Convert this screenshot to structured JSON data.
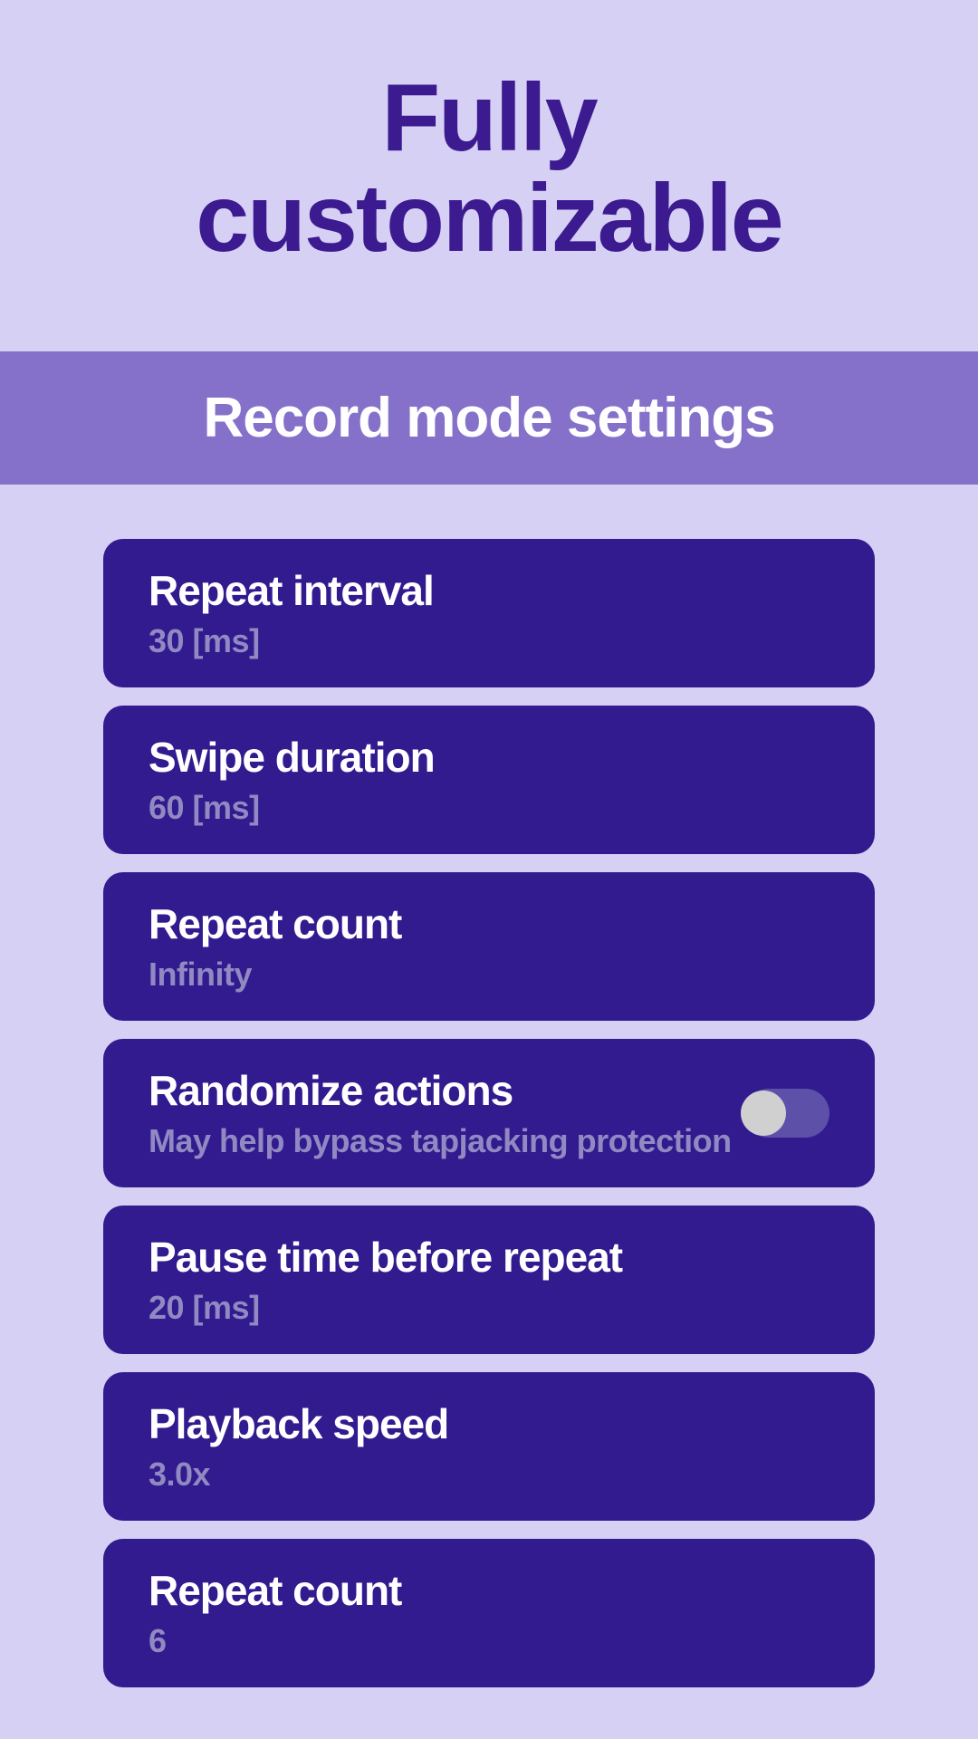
{
  "header": {
    "title_line1": "Fully",
    "title_line2": "customizable"
  },
  "section": {
    "title": "Record mode settings"
  },
  "settings": [
    {
      "title": "Repeat interval",
      "value": "30 [ms]",
      "has_toggle": false
    },
    {
      "title": "Swipe duration",
      "value": "60 [ms]",
      "has_toggle": false
    },
    {
      "title": "Repeat count",
      "value": "Infinity",
      "has_toggle": false
    },
    {
      "title": "Randomize actions",
      "value": "May help bypass tapjacking protection",
      "has_toggle": true,
      "toggle_state": "off"
    },
    {
      "title": "Pause time before repeat",
      "value": "20 [ms]",
      "has_toggle": false
    },
    {
      "title": "Playback speed",
      "value": "3.0x",
      "has_toggle": false
    },
    {
      "title": "Repeat count",
      "value": "6",
      "has_toggle": false
    }
  ]
}
